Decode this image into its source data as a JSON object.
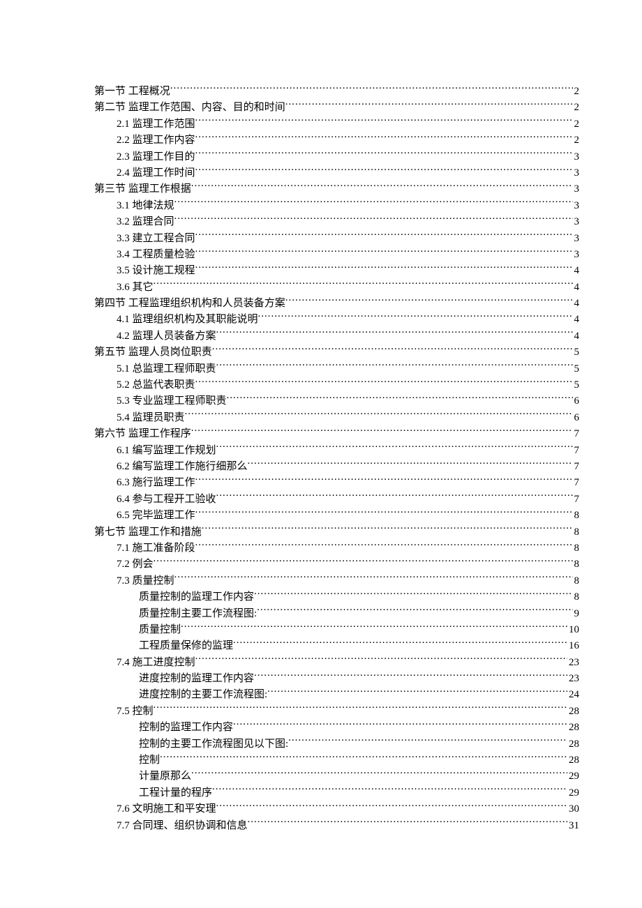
{
  "toc": [
    {
      "indent": 0,
      "label": "第一节 工程概况",
      "page": "2"
    },
    {
      "indent": 0,
      "label": "第二节 监理工作范围、内容、目的和时间",
      "page": "2"
    },
    {
      "indent": 1,
      "label": "2.1  监理工作范围",
      "page": "2"
    },
    {
      "indent": 1,
      "label": "2.2  监理工作内容",
      "page": "2"
    },
    {
      "indent": 1,
      "label": "2.3  监理工作目的",
      "page": "3"
    },
    {
      "indent": 1,
      "label": "2.4  监理工作时间",
      "page": "3"
    },
    {
      "indent": 0,
      "label": "第三节 监理工作根据",
      "page": "3"
    },
    {
      "indent": 1,
      "label": "3.1  地律法规",
      "page": "3"
    },
    {
      "indent": 1,
      "label": "3.2  监理合同",
      "page": "3"
    },
    {
      "indent": 1,
      "label": "3.3  建立工程合同",
      "page": "3"
    },
    {
      "indent": 1,
      "label": "3.4  工程质量检验",
      "page": "3"
    },
    {
      "indent": 1,
      "label": "3.5  设计施工规程",
      "page": "4"
    },
    {
      "indent": 1,
      "label": "3.6  其它",
      "page": "4"
    },
    {
      "indent": 0,
      "label": "第四节 工程监理组织机构和人员装备方案",
      "page": "4"
    },
    {
      "indent": 1,
      "label": "4.1  监理组织机构及其职能说明",
      "page": "4"
    },
    {
      "indent": 1,
      "label": "4.2  监理人员装备方案",
      "page": "4"
    },
    {
      "indent": 0,
      "label": "第五节 监理人员岗位职责",
      "page": "5"
    },
    {
      "indent": 1,
      "label": "5.1  总监理工程师职责",
      "page": "5"
    },
    {
      "indent": 1,
      "label": "5.2  总监代表职责",
      "page": "5"
    },
    {
      "indent": 1,
      "label": "5.3 专业监理工程师职责",
      "page": "6"
    },
    {
      "indent": 1,
      "label": "5.4  监理员职责",
      "page": "6"
    },
    {
      "indent": 0,
      "label": "第六节 监理工作程序",
      "page": "7"
    },
    {
      "indent": 1,
      "label": "6.1 编写监理工作规划",
      "page": "7"
    },
    {
      "indent": 1,
      "label": "6.2 编写监理工作施行细那么",
      "page": "7"
    },
    {
      "indent": 1,
      "label": "6.3  施行监理工作",
      "page": "7"
    },
    {
      "indent": 1,
      "label": "6.4 参与工程开工验收",
      "page": "7"
    },
    {
      "indent": 1,
      "label": "6.5 完毕监理工作",
      "page": "8"
    },
    {
      "indent": 0,
      "label": "第七节 监理工作和措施",
      "page": "8"
    },
    {
      "indent": 1,
      "label": "7.1 施工准备阶段",
      "page": "8"
    },
    {
      "indent": 1,
      "label": "7.2 例会",
      "page": "8"
    },
    {
      "indent": 1,
      "label": "7.3  质量控制",
      "page": "8"
    },
    {
      "indent": 2,
      "label": "质量控制的监理工作内容",
      "page": "8"
    },
    {
      "indent": 2,
      "label": "质量控制主要工作流程图:",
      "page": "9"
    },
    {
      "indent": 2,
      "label": "质量控制",
      "page": "10"
    },
    {
      "indent": 2,
      "label": "工程质量保修的监理",
      "page": "16"
    },
    {
      "indent": 1,
      "label": "7.4  施工进度控制",
      "page": "23"
    },
    {
      "indent": 2,
      "label": "进度控制的监理工作内容",
      "page": "23"
    },
    {
      "indent": 2,
      "label": "进度控制的主要工作流程图:",
      "page": "24"
    },
    {
      "indent": 1,
      "label": "7.5  控制",
      "page": "28"
    },
    {
      "indent": 2,
      "label": "控制的监理工作内容",
      "page": "28"
    },
    {
      "indent": 2,
      "label": "控制的主要工作流程图见以下图:",
      "page": "28"
    },
    {
      "indent": 2,
      "label": "控制",
      "page": "28"
    },
    {
      "indent": 2,
      "label": "计量原那么",
      "page": "29"
    },
    {
      "indent": 2,
      "label": "工程计量的程序",
      "page": "29"
    },
    {
      "indent": 1,
      "label": "7.6  文明施工和平安理",
      "page": "30"
    },
    {
      "indent": 1,
      "label": "7.7  合同理、组织协调和信息",
      "page": "31"
    }
  ]
}
